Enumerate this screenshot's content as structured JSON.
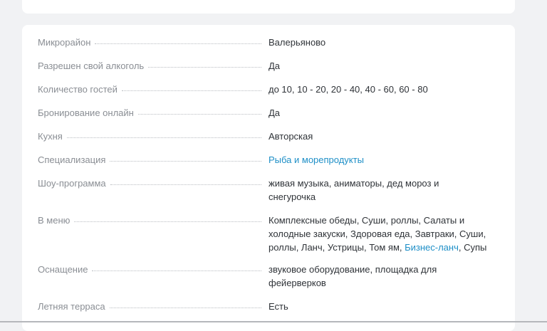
{
  "details": [
    {
      "label": "Микрорайон",
      "value": "Валерьяново"
    },
    {
      "label": "Разрешен свой алкоголь",
      "value": "Да"
    },
    {
      "label": "Количество гостей",
      "value": "до 10, 10 - 20, 20 - 40, 40 - 60, 60 - 80"
    },
    {
      "label": "Бронирование онлайн",
      "value": "Да"
    },
    {
      "label": "Кухня",
      "value": "Авторская"
    },
    {
      "label": "Специализация",
      "value": "Рыба и морепродукты"
    },
    {
      "label": "Шоу-программа",
      "value": "живая музыка, аниматоры, дед мороз и снегурочка"
    },
    {
      "label": "В меню",
      "value_before": "Комплексные обеды, Суши, роллы, Салаты и холодные закуски, Здоровая еда, Завтраки, Суши, роллы, Ланч, Устрицы, Том ям, ",
      "value_link": "Бизнес-ланч",
      "value_after": ", Супы"
    },
    {
      "label": "Оснащение",
      "value": "звуковое оборудование, площадка для фейерверков"
    },
    {
      "label": "Летняя терраса",
      "value": "Есть"
    }
  ],
  "colors": {
    "link": "#1e8fc7",
    "label": "#8a8e94",
    "value": "#2f3338",
    "background": "#f1f2f4"
  }
}
